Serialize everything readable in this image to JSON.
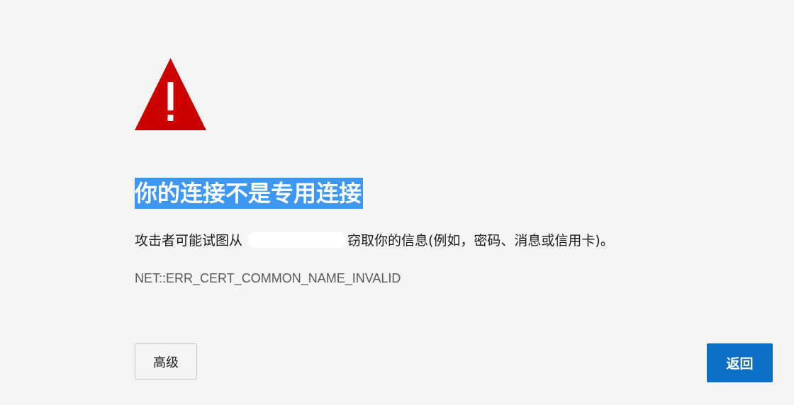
{
  "icon": {
    "name": "warning-triangle-icon",
    "color": "#cc0000",
    "mark": "!"
  },
  "heading": {
    "title": "你的连接不是专用连接",
    "highlight_color": "#3d97f5"
  },
  "message": {
    "prefix": "攻击者可能试图从",
    "suffix": "窃取你的信息(例如，密码、消息或信用卡)。"
  },
  "error_code": "NET::ERR_CERT_COMMON_NAME_INVALID",
  "buttons": {
    "advanced_label": "高级",
    "back_label": "返回",
    "back_color": "#0b6fc6"
  }
}
